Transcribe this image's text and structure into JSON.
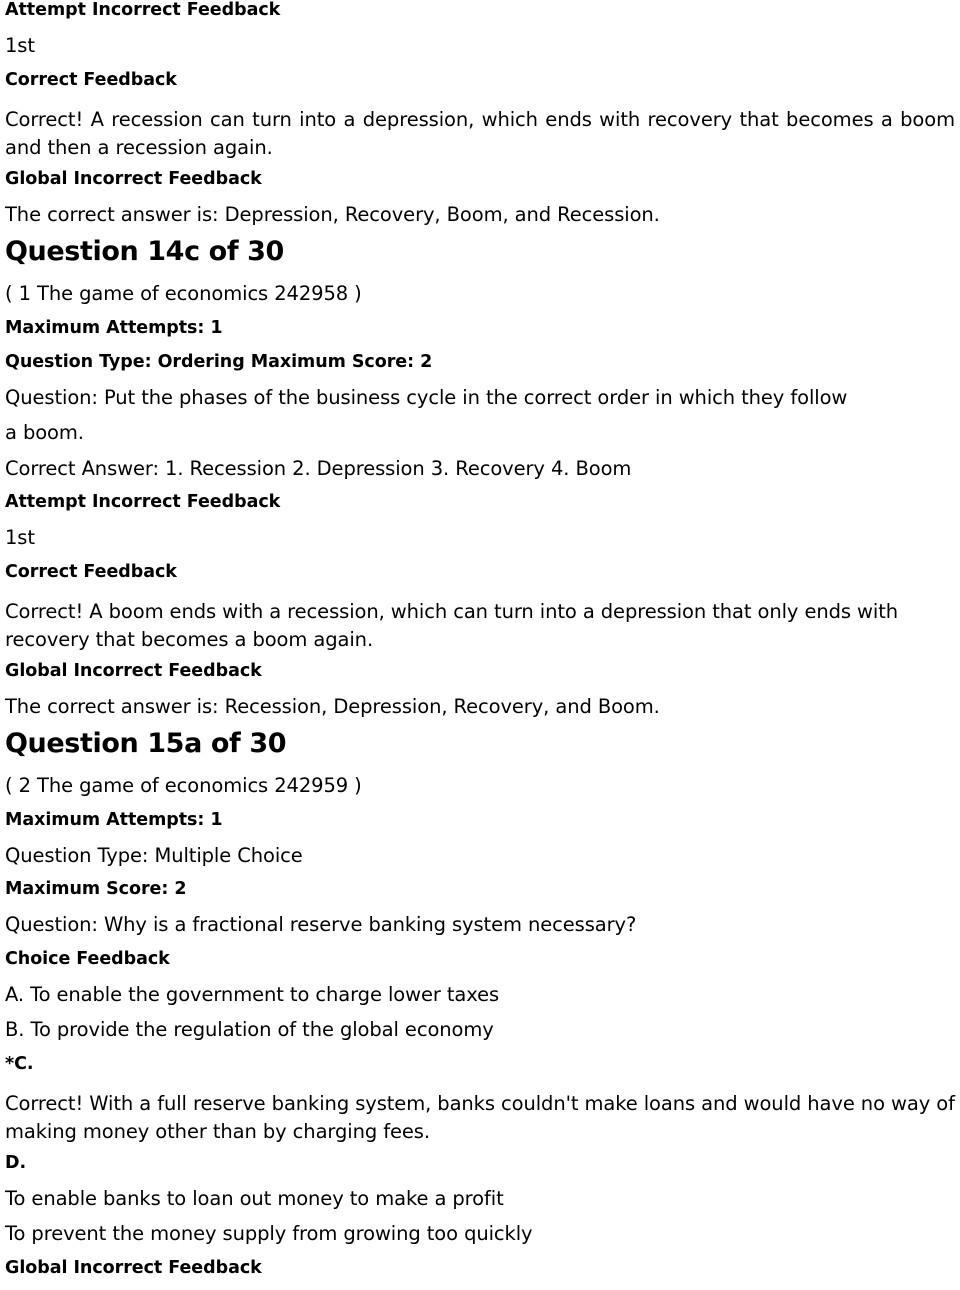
{
  "document": {
    "type": "quiz-answer-key",
    "blocks": [
      {
        "id": "b1",
        "role": "label",
        "text": "Attempt Incorrect Feedback"
      },
      {
        "id": "b2",
        "role": "value",
        "text": "1st"
      },
      {
        "id": "b3",
        "role": "label",
        "text": "Correct Feedback"
      },
      {
        "id": "b4",
        "role": "paragraph",
        "text": "Correct! A recession can turn into a depression, which ends with recovery that becomes a boom and then a recession again."
      },
      {
        "id": "b5",
        "role": "label",
        "text": "Global Incorrect Feedback"
      },
      {
        "id": "b6",
        "role": "value",
        "text": "The correct answer is: Depression, Recovery, Boom, and Recession."
      },
      {
        "id": "b7",
        "role": "heading",
        "text": "Question 14c of 30"
      },
      {
        "id": "b8",
        "role": "value",
        "text": "( 1 The game of economics 242958 )"
      },
      {
        "id": "b9",
        "role": "label",
        "text": "Maximum Attempts: 1"
      },
      {
        "id": "b10",
        "role": "label",
        "text": "Question Type: Ordering Maximum Score: 2"
      },
      {
        "id": "b11",
        "role": "value",
        "text": "Question: Put the phases of the business cycle in the correct order in which they follow"
      },
      {
        "id": "b12",
        "role": "value",
        "text": "a boom."
      },
      {
        "id": "b13",
        "role": "value",
        "text": "Correct Answer: 1. Recession 2. Depression 3. Recovery 4. Boom"
      },
      {
        "id": "b14",
        "role": "label",
        "text": "Attempt Incorrect Feedback"
      },
      {
        "id": "b15",
        "role": "value",
        "text": "1st"
      },
      {
        "id": "b16",
        "role": "label",
        "text": "Correct Feedback"
      },
      {
        "id": "b17",
        "role": "paragraph",
        "text": "Correct! A boom ends with a recession, which can turn into a depression that only ends with recovery that becomes a boom again."
      },
      {
        "id": "b18",
        "role": "label",
        "text": "Global Incorrect Feedback"
      },
      {
        "id": "b19",
        "role": "value",
        "text": "The correct answer is: Recession, Depression, Recovery, and Boom."
      },
      {
        "id": "b20",
        "role": "heading",
        "text": "Question 15a of 30"
      },
      {
        "id": "b21",
        "role": "value",
        "text": "( 2 The game of economics 242959 )"
      },
      {
        "id": "b22",
        "role": "label",
        "text": "Maximum Attempts: 1"
      },
      {
        "id": "b23",
        "role": "value",
        "text": "Question Type: Multiple Choice"
      },
      {
        "id": "b24",
        "role": "label",
        "text": "Maximum Score: 2"
      },
      {
        "id": "b25",
        "role": "value",
        "text": "Question: Why is a fractional reserve banking system necessary?"
      },
      {
        "id": "b26",
        "role": "label",
        "text": "Choice Feedback"
      },
      {
        "id": "b27",
        "role": "value",
        "text": "A. To enable the government to charge lower taxes"
      },
      {
        "id": "b28",
        "role": "value",
        "text": "B. To provide the regulation of the global economy"
      },
      {
        "id": "b29",
        "role": "label",
        "text": "*C."
      },
      {
        "id": "b30",
        "role": "paragraph",
        "text": "Correct! With a full reserve banking system, banks couldn't make loans and would have no way of making money other than by charging fees."
      },
      {
        "id": "b31",
        "role": "label",
        "text": "D."
      },
      {
        "id": "b32",
        "role": "value",
        "text": "To enable banks to loan out money to make a profit"
      },
      {
        "id": "b33",
        "role": "value",
        "text": "To prevent the money supply from growing too quickly"
      },
      {
        "id": "b34",
        "role": "label",
        "text": "Global Incorrect Feedback"
      }
    ]
  }
}
